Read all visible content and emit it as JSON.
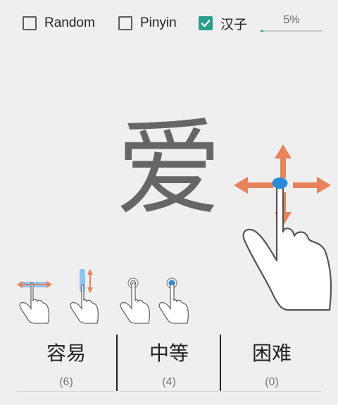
{
  "accent": "#2a9d8f",
  "arrow_color": "#e8825a",
  "finger_dot_color": "#2b8ad6",
  "options": [
    {
      "label": "Random",
      "checked": false
    },
    {
      "label": "Pinyin",
      "checked": false
    },
    {
      "label": "汉子",
      "checked": true
    }
  ],
  "progress": {
    "label": "5%",
    "value": 0.05
  },
  "character": "爱",
  "gesture_icons": [
    "swipe-horizontal-icon",
    "swipe-vertical-icon",
    "tap-icon",
    "long-press-icon"
  ],
  "large_gesture_icon": "swipe-all-directions-icon",
  "difficulty": [
    {
      "label": "容易",
      "count": "(6)"
    },
    {
      "label": "中等",
      "count": "(4)"
    },
    {
      "label": "困难",
      "count": "(0)"
    }
  ]
}
